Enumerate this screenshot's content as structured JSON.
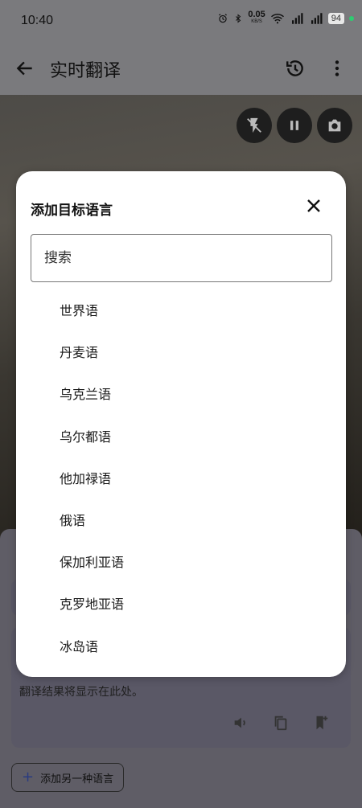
{
  "status_bar": {
    "time": "10:40",
    "net_speed_value": "0.05",
    "net_speed_unit": "KB/S",
    "battery": "94",
    "icons": [
      "alarm-icon",
      "bluetooth-icon",
      "wifi-icon",
      "signal-5g-icon",
      "signal-5g-icon-2"
    ]
  },
  "app_bar": {
    "title": "实时翻译",
    "icons": [
      "back-arrow-icon",
      "history-icon",
      "more-vert-icon"
    ]
  },
  "camera_controls": [
    "flash-off-icon",
    "pause-icon",
    "camera-icon"
  ],
  "dialog": {
    "title": "添加目标语言",
    "search_placeholder": "搜索",
    "languages": [
      "世界语",
      "丹麦语",
      "乌克兰语",
      "乌尔都语",
      "他加禄语",
      "俄语",
      "保加利亚语",
      "克罗地亚语",
      "冰岛语"
    ]
  },
  "result": {
    "placeholder_text": "翻译结果将显示在此处。",
    "icons": [
      "speaker-icon",
      "copy-icon",
      "bookmark-add-icon"
    ]
  },
  "add_language_button": {
    "label": "添加另一种语言"
  },
  "colors": {
    "scrim": "#6f6f72",
    "dialog_bg": "#ffffff",
    "camera_button": "#1e1e1e"
  }
}
